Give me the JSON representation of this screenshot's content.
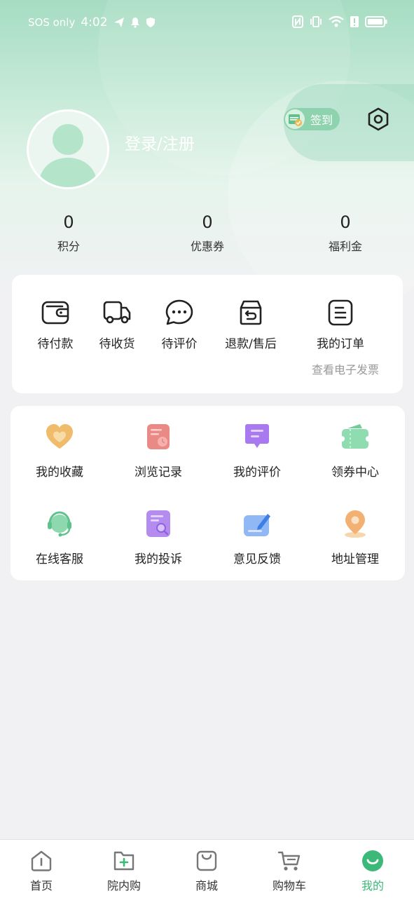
{
  "status_bar": {
    "carrier": "SOS only",
    "time": "4:02"
  },
  "profile": {
    "login_label": "登录/注册",
    "checkin_label": "签到"
  },
  "stats": [
    {
      "value": "0",
      "label": "积分"
    },
    {
      "value": "0",
      "label": "优惠券"
    },
    {
      "value": "0",
      "label": "福利金"
    }
  ],
  "orders": {
    "items": [
      {
        "label": "待付款",
        "icon": "wallet-icon"
      },
      {
        "label": "待收货",
        "icon": "truck-icon"
      },
      {
        "label": "待评价",
        "icon": "chat-icon"
      },
      {
        "label": "退款/售后",
        "icon": "return-box-icon"
      },
      {
        "label": "我的订单",
        "icon": "order-list-icon"
      }
    ],
    "invoice_link": "查看电子发票"
  },
  "services": [
    {
      "label": "我的收藏",
      "icon": "heart-icon"
    },
    {
      "label": "浏览记录",
      "icon": "history-icon"
    },
    {
      "label": "我的评价",
      "icon": "review-icon"
    },
    {
      "label": "领券中心",
      "icon": "coupon-icon"
    },
    {
      "label": "在线客服",
      "icon": "headset-icon"
    },
    {
      "label": "我的投诉",
      "icon": "complaint-icon"
    },
    {
      "label": "意见反馈",
      "icon": "feedback-icon"
    },
    {
      "label": "地址管理",
      "icon": "location-icon"
    }
  ],
  "tabbar": [
    {
      "label": "首页",
      "icon": "home-icon"
    },
    {
      "label": "院内购",
      "icon": "hospital-shop-icon"
    },
    {
      "label": "商城",
      "icon": "shopping-bag-icon"
    },
    {
      "label": "购物车",
      "icon": "cart-icon"
    },
    {
      "label": "我的",
      "icon": "profile-icon",
      "active": true
    }
  ],
  "colors": {
    "accent": "#3cb878",
    "header_green": "#a6dcc2"
  }
}
